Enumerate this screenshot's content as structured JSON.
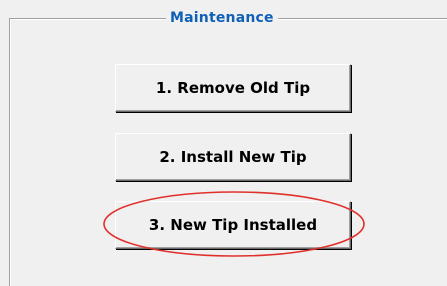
{
  "groupbox": {
    "title": "Maintenance"
  },
  "buttons": [
    {
      "label": "1. Remove Old Tip"
    },
    {
      "label": "2. Install New Tip"
    },
    {
      "label": "3. New Tip Installed"
    }
  ],
  "colors": {
    "title": "#1060b8",
    "highlight_ring": "#e0302c",
    "background": "#f0f0f0"
  }
}
